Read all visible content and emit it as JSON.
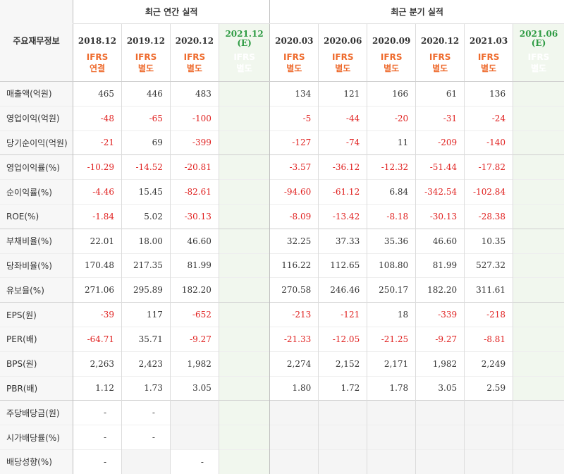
{
  "header": {
    "label": "주요재무정보",
    "annual_title": "최근 연간 실적",
    "quarter_title": "최근 분기 실적"
  },
  "periods": [
    {
      "date": "2018.12",
      "std": "IFRS",
      "type": "연결",
      "est": ""
    },
    {
      "date": "2019.12",
      "std": "IFRS",
      "type": "별도",
      "est": ""
    },
    {
      "date": "2020.12",
      "std": "IFRS",
      "type": "별도",
      "est": ""
    },
    {
      "date": "2021.12",
      "std": "IFRS",
      "type": "별도",
      "est": "(E)"
    },
    {
      "date": "2020.03",
      "std": "IFRS",
      "type": "별도",
      "est": ""
    },
    {
      "date": "2020.06",
      "std": "IFRS",
      "type": "별도",
      "est": ""
    },
    {
      "date": "2020.09",
      "std": "IFRS",
      "type": "별도",
      "est": ""
    },
    {
      "date": "2020.12",
      "std": "IFRS",
      "type": "별도",
      "est": ""
    },
    {
      "date": "2021.03",
      "std": "IFRS",
      "type": "별도",
      "est": ""
    },
    {
      "date": "2021.06",
      "std": "IFRS",
      "type": "별도",
      "est": "(E)"
    }
  ],
  "rows": [
    {
      "label": "매출액(억원)",
      "values": [
        "465",
        "446",
        "483",
        "",
        "134",
        "121",
        "166",
        "61",
        "136",
        ""
      ]
    },
    {
      "label": "영업이익(억원)",
      "values": [
        "-48",
        "-65",
        "-100",
        "",
        "-5",
        "-44",
        "-20",
        "-31",
        "-24",
        ""
      ]
    },
    {
      "label": "당기순이익(억원)",
      "values": [
        "-21",
        "69",
        "-399",
        "",
        "-127",
        "-74",
        "11",
        "-209",
        "-140",
        ""
      ]
    },
    {
      "label": "영업이익률(%)",
      "values": [
        "-10.29",
        "-14.52",
        "-20.81",
        "",
        "-3.57",
        "-36.12",
        "-12.32",
        "-51.44",
        "-17.82",
        ""
      ]
    },
    {
      "label": "순이익률(%)",
      "values": [
        "-4.46",
        "15.45",
        "-82.61",
        "",
        "-94.60",
        "-61.12",
        "6.84",
        "-342.54",
        "-102.84",
        ""
      ]
    },
    {
      "label": "ROE(%)",
      "values": [
        "-1.84",
        "5.02",
        "-30.13",
        "",
        "-8.09",
        "-13.42",
        "-8.18",
        "-30.13",
        "-28.38",
        ""
      ]
    },
    {
      "label": "부채비율(%)",
      "values": [
        "22.01",
        "18.00",
        "46.60",
        "",
        "32.25",
        "37.33",
        "35.36",
        "46.60",
        "10.35",
        ""
      ]
    },
    {
      "label": "당좌비율(%)",
      "values": [
        "170.48",
        "217.35",
        "81.99",
        "",
        "116.22",
        "112.65",
        "108.80",
        "81.99",
        "527.32",
        ""
      ]
    },
    {
      "label": "유보율(%)",
      "values": [
        "271.06",
        "295.89",
        "182.20",
        "",
        "270.58",
        "246.46",
        "250.17",
        "182.20",
        "311.61",
        ""
      ]
    },
    {
      "label": "EPS(원)",
      "values": [
        "-39",
        "117",
        "-652",
        "",
        "-213",
        "-121",
        "18",
        "-339",
        "-218",
        ""
      ]
    },
    {
      "label": "PER(배)",
      "values": [
        "-64.71",
        "35.71",
        "-9.27",
        "",
        "-21.33",
        "-12.05",
        "-21.25",
        "-9.27",
        "-8.81",
        ""
      ]
    },
    {
      "label": "BPS(원)",
      "values": [
        "2,263",
        "2,423",
        "1,982",
        "",
        "2,274",
        "2,152",
        "2,171",
        "1,982",
        "2,249",
        ""
      ]
    },
    {
      "label": "PBR(배)",
      "values": [
        "1.12",
        "1.73",
        "3.05",
        "",
        "1.80",
        "1.72",
        "1.78",
        "3.05",
        "2.59",
        ""
      ]
    },
    {
      "label": "주당배당금(원)",
      "values": [
        "-",
        "-",
        null,
        "",
        null,
        null,
        null,
        null,
        null,
        null
      ]
    },
    {
      "label": "시가배당률(%)",
      "values": [
        "-",
        "-",
        null,
        "",
        null,
        null,
        null,
        null,
        null,
        null
      ]
    },
    {
      "label": "배당성향(%)",
      "values": [
        "-",
        null,
        "-",
        "",
        null,
        null,
        null,
        null,
        null,
        null
      ]
    }
  ],
  "colors": {
    "negative": "#e0201f",
    "ifrs": "#ee6a2c",
    "estimate": "#2e9b43"
  }
}
